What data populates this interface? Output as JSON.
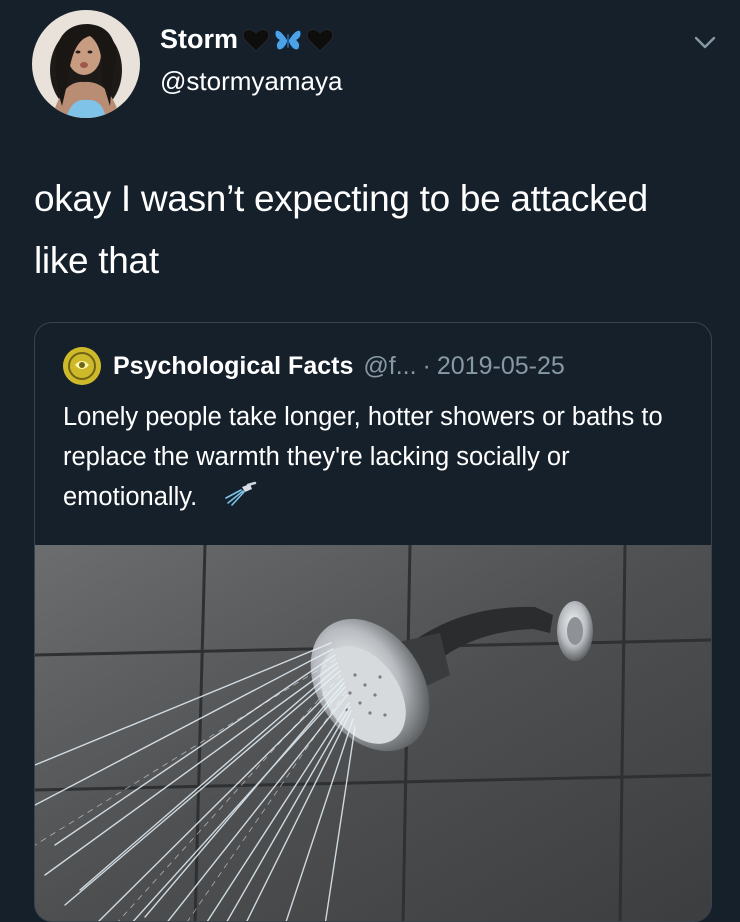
{
  "tweet": {
    "display_name": "Storm",
    "handle": "@stormyamaya",
    "name_emojis": [
      "black-heart-icon",
      "blue-butterfly-icon",
      "black-heart-icon"
    ],
    "text": "okay I wasn’t expecting to be attacked like that"
  },
  "quote": {
    "name": "Psychological Facts",
    "handle": "@f...",
    "separator": "·",
    "date": "2019-05-25",
    "text": "Lonely people take longer, hotter showers or baths to replace the warmth they're lacking socially or emotionally.",
    "text_emoji": "shower-icon",
    "image_subject": "shower-head-spraying-water"
  },
  "colors": {
    "background": "#15202b",
    "border": "#38444d",
    "secondary_text": "#8899a6",
    "butterfly": "#4aa3e8"
  }
}
